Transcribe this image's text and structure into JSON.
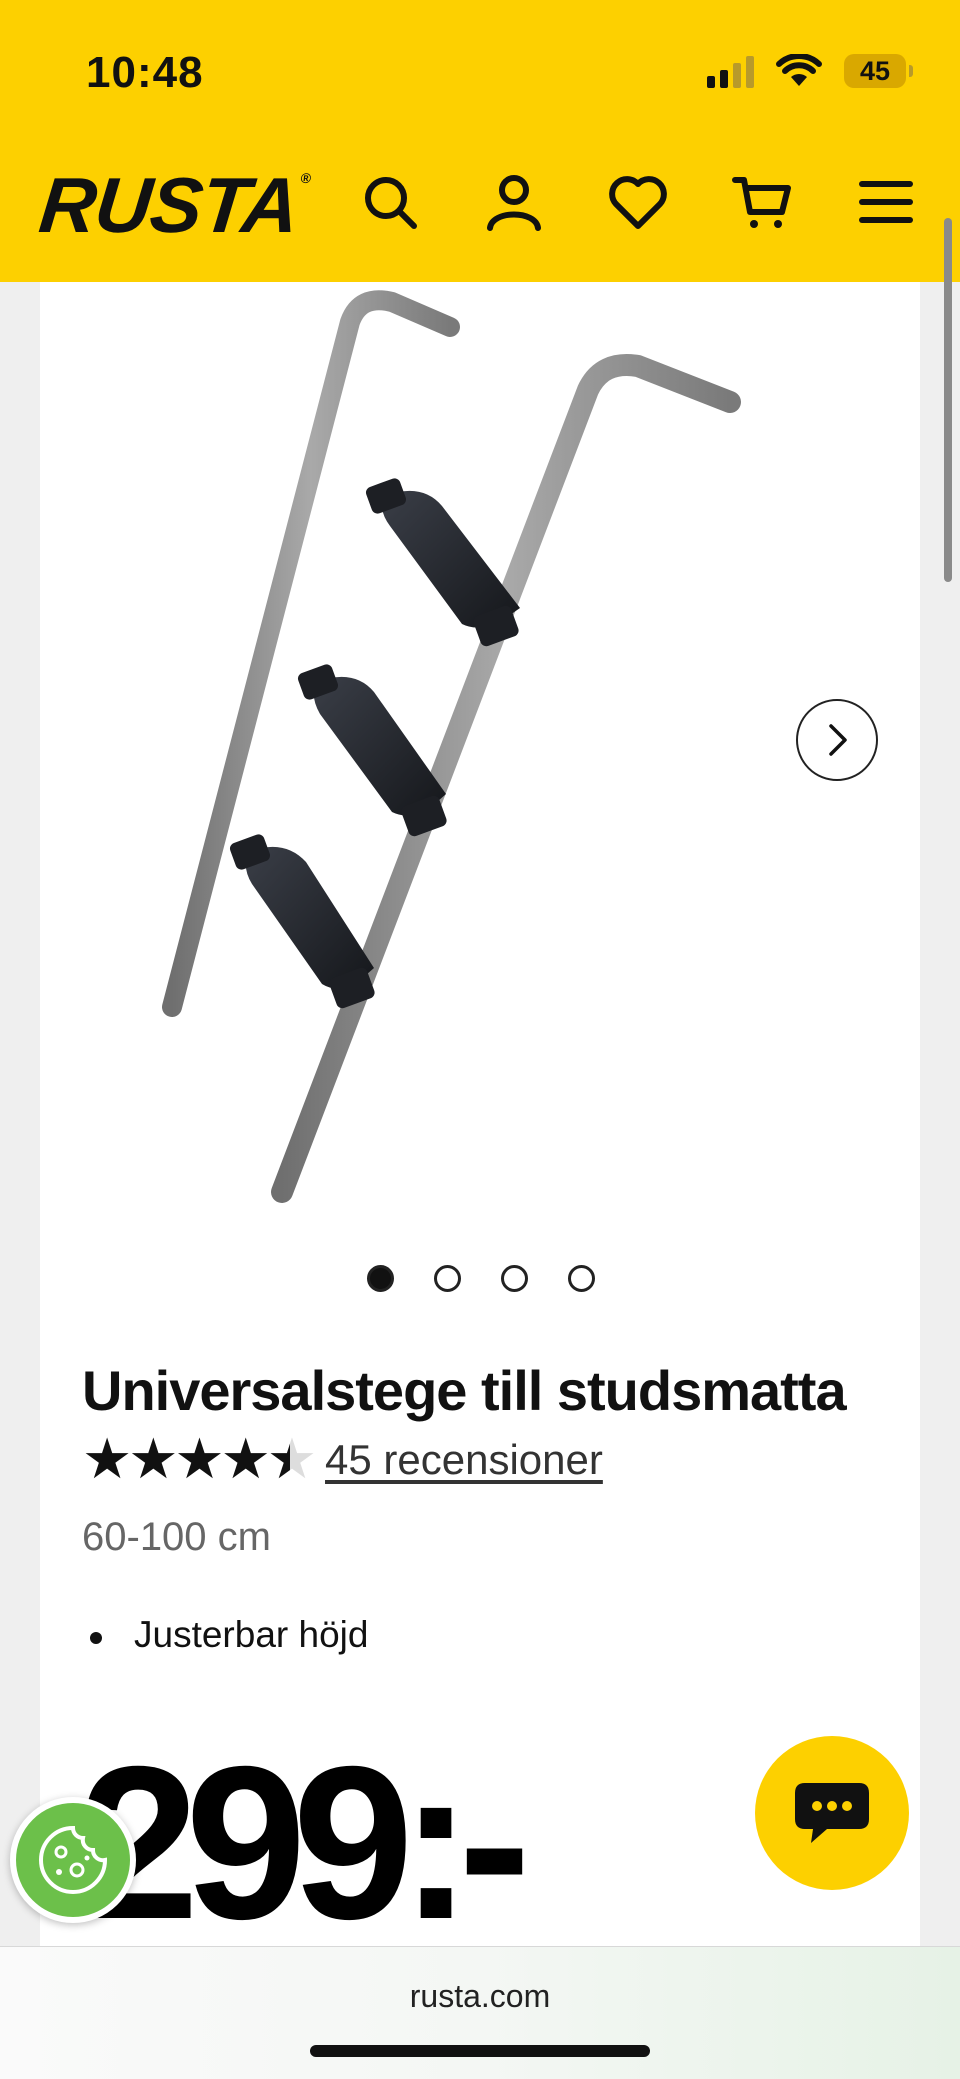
{
  "status_bar": {
    "time": "10:48",
    "battery": "45"
  },
  "header": {
    "logo": "RUSTA",
    "logo_mark": "®",
    "icons": [
      "search-icon",
      "account-icon",
      "heart-icon",
      "cart-icon",
      "menu-icon"
    ]
  },
  "gallery": {
    "image_count": 4,
    "active_index": 0
  },
  "product": {
    "title": "Universalstege till studsmatta",
    "rating": 4.5,
    "rating_max": 5,
    "stars_text": "★★★★★",
    "reviews": "45 recensioner",
    "variant": "60-100 cm",
    "features": [
      "Justerbar höjd"
    ],
    "price": "299:-"
  },
  "browser": {
    "url": "rusta.com"
  },
  "colors": {
    "brand_yellow": "#fdd000",
    "cookie_green": "#6cc04a",
    "text_dark": "#111111"
  }
}
